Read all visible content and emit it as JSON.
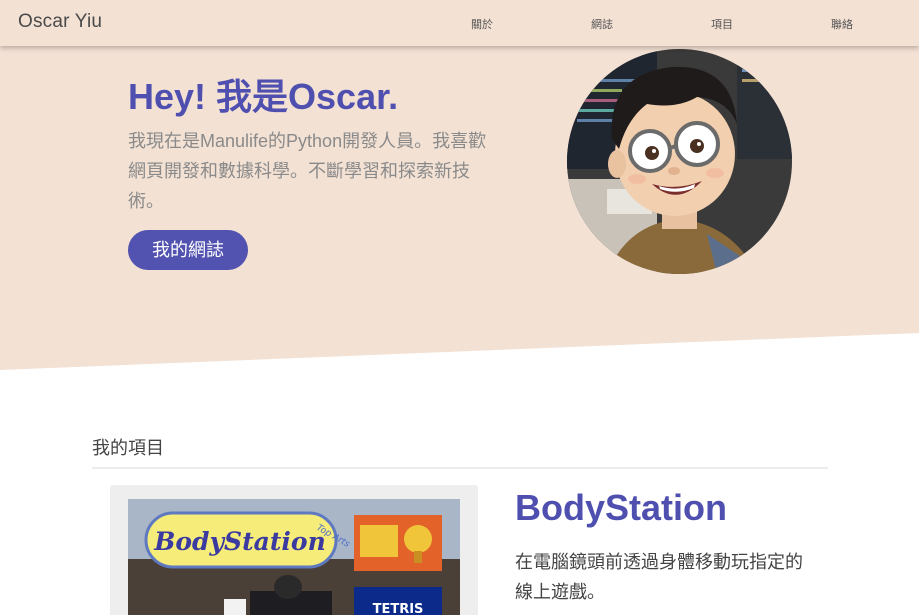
{
  "navbar": {
    "brand": "Oscar Yiu",
    "items": [
      {
        "label": "關於"
      },
      {
        "label": "網誌"
      },
      {
        "label": "項目"
      },
      {
        "label": "聯絡"
      }
    ]
  },
  "hero": {
    "title": "Hey! 我是Oscar.",
    "description": "我現在是Manulife的Python開發人員。我喜歡網頁開發和數據科學。不斷學習和探索新技術。",
    "button_label": "我的網誌"
  },
  "projects": {
    "section_title": "我的項目",
    "items": [
      {
        "title": "BodyStation",
        "description": "在電腦鏡頭前透過身體移動玩指定的線上遊戲。"
      }
    ]
  },
  "colors": {
    "accent": "#5252b0",
    "hero_background": "#f3e1d4"
  }
}
